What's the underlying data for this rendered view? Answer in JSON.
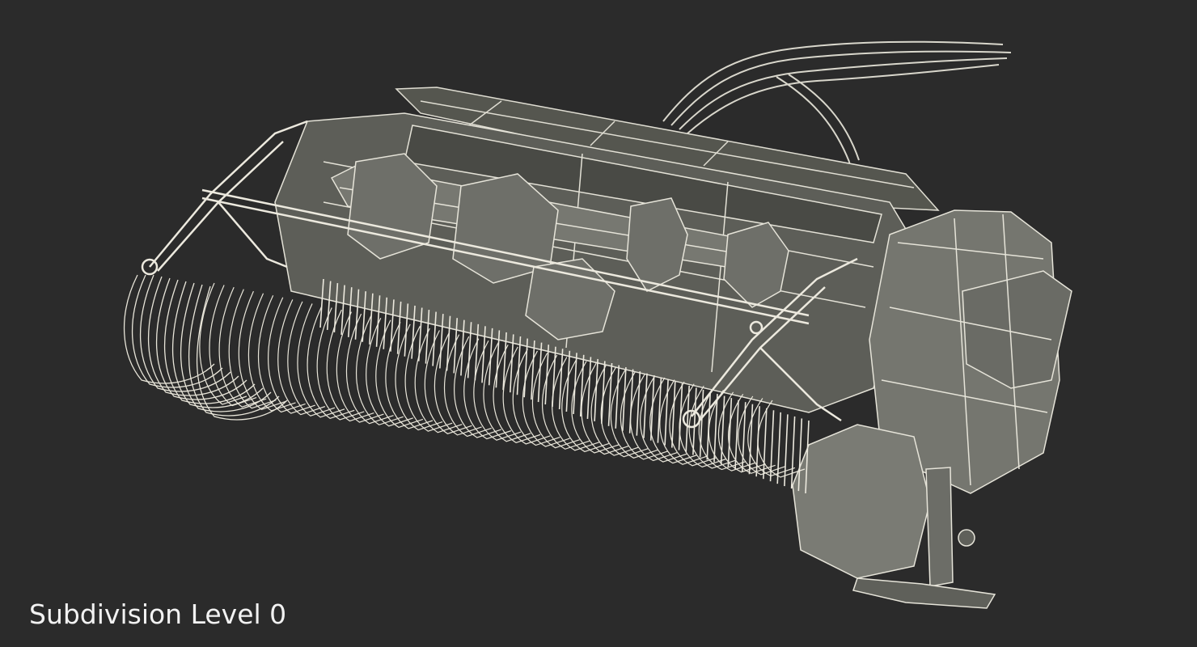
{
  "caption": "Subdivision Level 0",
  "colors": {
    "background": "#2b2b2b",
    "body_fill": "#6b6c66",
    "body_dark": "#4d4e49",
    "wire": "#e8e6dc",
    "caption_text": "#f2f2f2"
  },
  "render": {
    "subject": "forage-harvester-pickup-header-wireframe"
  }
}
